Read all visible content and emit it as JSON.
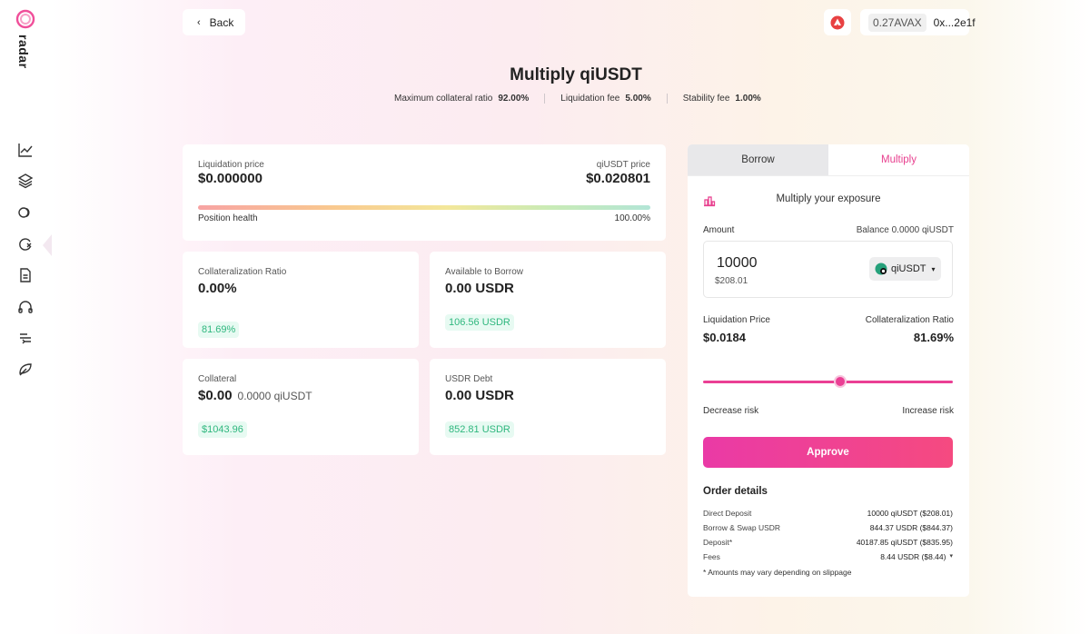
{
  "app": {
    "brand": "radar"
  },
  "header": {
    "back_label": "Back",
    "wallet_balance": "0.27AVAX",
    "wallet_address": "0x...2e1f"
  },
  "page": {
    "title": "Multiply qiUSDT",
    "stats": [
      {
        "label": "Maximum collateral ratio",
        "value": "92.00%"
      },
      {
        "label": "Liquidation fee",
        "value": "5.00%"
      },
      {
        "label": "Stability fee",
        "value": "1.00%"
      }
    ]
  },
  "position": {
    "liq_price_label": "Liquidation price",
    "liq_price_value": "$0.000000",
    "token_price_label": "qiUSDT price",
    "token_price_value": "$0.020801",
    "health_label": "Position health",
    "health_value": "100.00%"
  },
  "cards": {
    "coll_ratio": {
      "label": "Collateralization Ratio",
      "value": "0.00%",
      "projected": "81.69%"
    },
    "avail_borrow": {
      "label": "Available to Borrow",
      "value": "0.00 USDR",
      "projected": "106.56 USDR"
    },
    "collateral": {
      "label": "Collateral",
      "value": "$0.00",
      "sub": "0.0000 qiUSDT",
      "projected": "$1043.96"
    },
    "debt": {
      "label": "USDR Debt",
      "value": "0.00 USDR",
      "projected": "852.81 USDR"
    }
  },
  "panel": {
    "tab_borrow": "Borrow",
    "tab_multiply": "Multiply",
    "subtitle": "Multiply your exposure",
    "amount_label": "Amount",
    "balance": "Balance 0.0000 qiUSDT",
    "amount_value": "10000",
    "amount_usd": "$208.01",
    "token": "qiUSDT",
    "liq_price_label": "Liquidation Price",
    "liq_price_value": "$0.0184",
    "coll_ratio_label": "Collateralization Ratio",
    "coll_ratio_value": "81.69%",
    "risk_level": 0.55,
    "decrease_risk": "Decrease risk",
    "increase_risk": "Increase risk",
    "approve": "Approve",
    "order_title": "Order details",
    "order": [
      {
        "label": "Direct Deposit",
        "value": "10000 qiUSDT ($208.01)"
      },
      {
        "label": "Borrow & Swap USDR",
        "value": "844.37 USDR ($844.37)"
      },
      {
        "label": "Deposit*",
        "value": "40187.85 qiUSDT ($835.95)"
      },
      {
        "label": "Fees",
        "value": "8.44 USDR ($8.44)"
      }
    ],
    "footnote": "* Amounts may vary depending on slippage"
  },
  "colors": {
    "accent": "#e8408f",
    "positive": "#2fb77e"
  }
}
